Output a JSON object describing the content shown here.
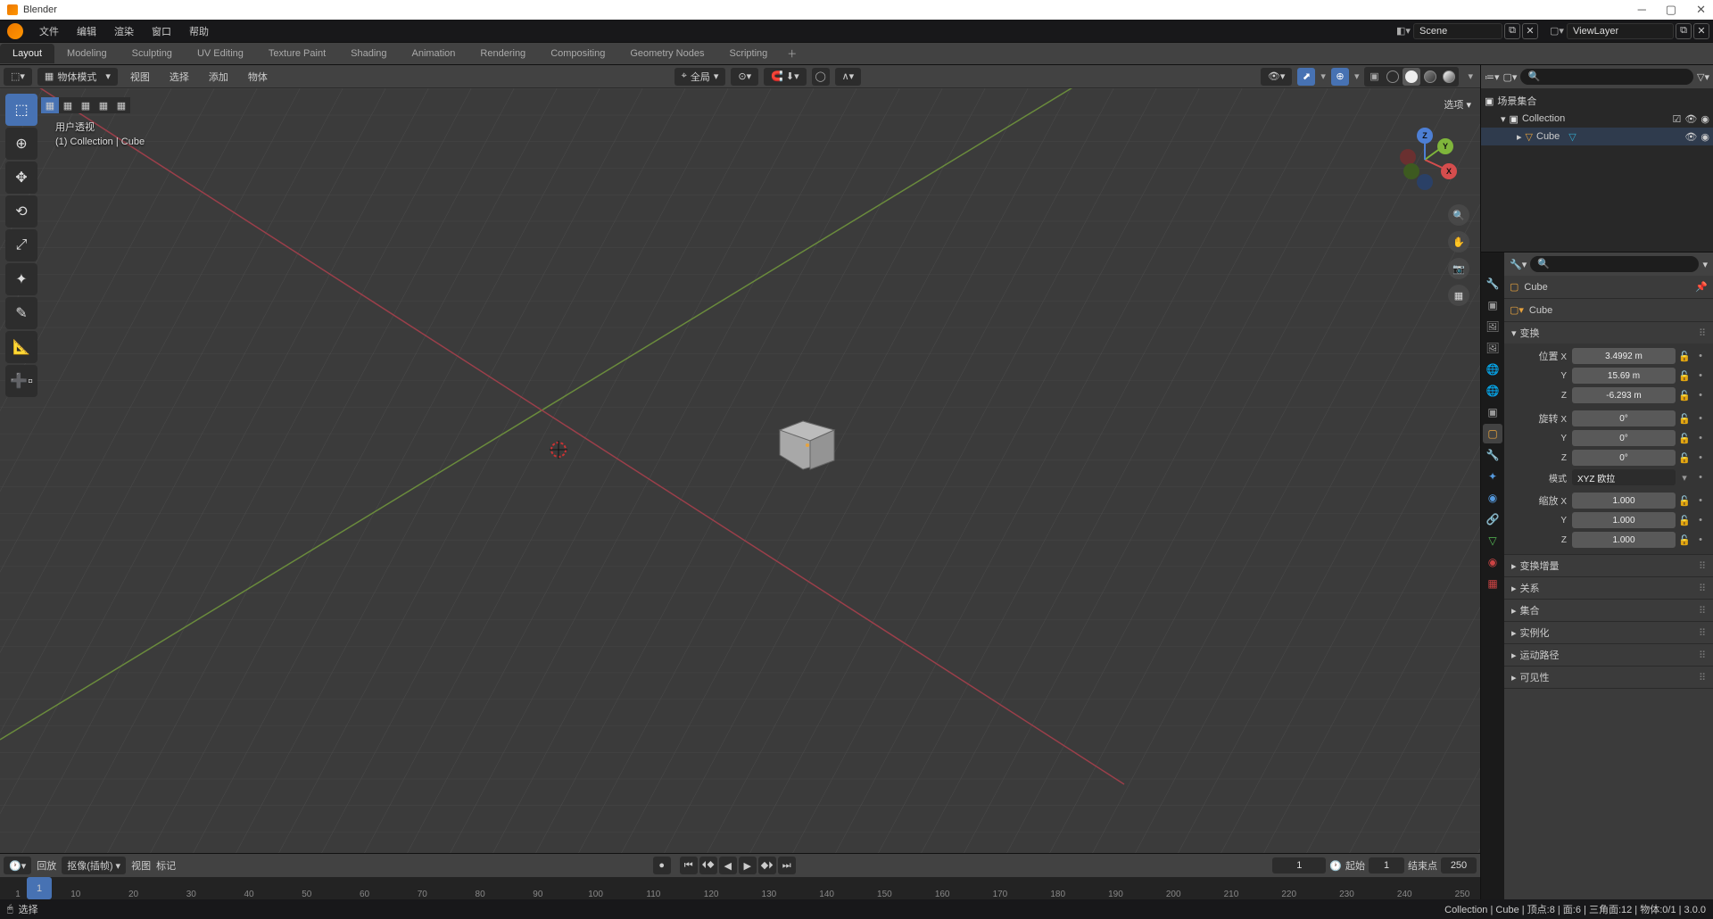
{
  "title": "Blender",
  "topmenu": [
    "文件",
    "编辑",
    "渲染",
    "窗口",
    "帮助"
  ],
  "workspaces": [
    "Layout",
    "Modeling",
    "Sculpting",
    "UV Editing",
    "Texture Paint",
    "Shading",
    "Animation",
    "Rendering",
    "Compositing",
    "Geometry Nodes",
    "Scripting"
  ],
  "activeWs": 0,
  "scene": {
    "name": "Scene",
    "layer": "ViewLayer"
  },
  "viewport": {
    "mode": "物体模式",
    "menus": [
      "视图",
      "选择",
      "添加",
      "物体"
    ],
    "orient": "全局",
    "label1": "用户透视",
    "label2": "(1) Collection | Cube",
    "options": "选项"
  },
  "outliner": {
    "root": "场景集合",
    "collection": "Collection",
    "cube": "Cube"
  },
  "props": {
    "object": "Cube",
    "mesh": "Cube",
    "panels": {
      "transform": "变换",
      "location": "位置",
      "rotation": "旋转",
      "scale": "缩放",
      "mode": "模式",
      "modeValue": "XYZ 欧拉",
      "loc": {
        "x": "3.4992 m",
        "y": "15.69 m",
        "z": "-6.293 m"
      },
      "rot": {
        "x": "0°",
        "y": "0°",
        "z": "0°"
      },
      "scl": {
        "x": "1.000",
        "y": "1.000",
        "z": "1.000"
      },
      "delta": "变换增量",
      "relations": "关系",
      "collections": "集合",
      "instancing": "实例化",
      "motion": "运动路径",
      "visibility": "可见性"
    }
  },
  "timeline": {
    "menus": [
      "回放",
      "抠像(插帧)",
      "视图",
      "标记"
    ],
    "cur": 1,
    "start": "起始",
    "startV": 1,
    "end": "结束点",
    "endV": 250,
    "ticks": [
      1,
      10,
      20,
      30,
      40,
      50,
      60,
      70,
      80,
      90,
      100,
      110,
      120,
      130,
      140,
      150,
      160,
      170,
      180,
      190,
      200,
      210,
      220,
      230,
      240,
      250
    ]
  },
  "status": {
    "left": "选择",
    "right": "Collection | Cube | 顶点:8 | 面:6 | 三角面:12 | 物体:0/1 | 3.0.0"
  }
}
